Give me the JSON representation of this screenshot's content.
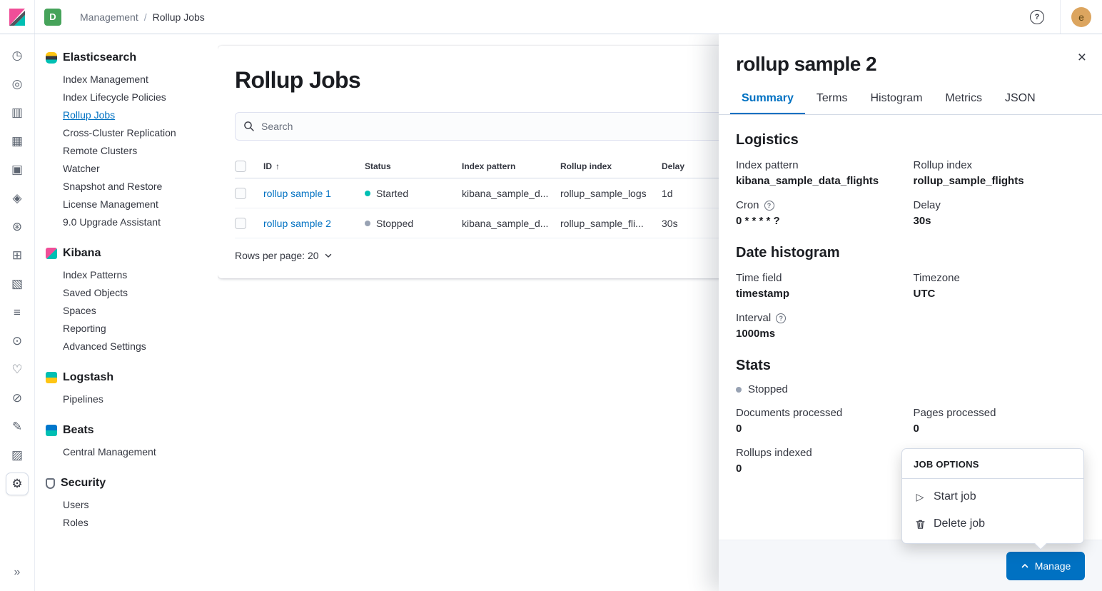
{
  "topbar": {
    "space_badge": "D",
    "breadcrumbs": [
      {
        "label": "Management"
      },
      {
        "label": "Rollup Jobs"
      }
    ],
    "separator": "/",
    "avatar_initial": "e"
  },
  "rail": {
    "icons": [
      {
        "name": "recent",
        "glyph": "◷"
      },
      {
        "name": "discover",
        "glyph": "◎"
      },
      {
        "name": "visualize",
        "glyph": "▥"
      },
      {
        "name": "dashboard",
        "glyph": "▦"
      },
      {
        "name": "canvas",
        "glyph": "▣"
      },
      {
        "name": "maps",
        "glyph": "◈"
      },
      {
        "name": "machine-learning",
        "glyph": "⊛"
      },
      {
        "name": "graph",
        "glyph": "⊞"
      },
      {
        "name": "metrics",
        "glyph": "▧"
      },
      {
        "name": "logs",
        "glyph": "≡"
      },
      {
        "name": "apm",
        "glyph": "⊙"
      },
      {
        "name": "uptime",
        "glyph": "♡"
      },
      {
        "name": "siem",
        "glyph": "⊘"
      },
      {
        "name": "dev-tools",
        "glyph": "✎"
      },
      {
        "name": "stack-monitoring",
        "glyph": "▨"
      },
      {
        "name": "stack-management",
        "glyph": "⚙",
        "selected": true
      }
    ],
    "collapse_glyph": "»"
  },
  "sidebar": {
    "selected_item": "Rollup Jobs",
    "sections": [
      {
        "title": "Elasticsearch",
        "items": [
          "Index Management",
          "Index Lifecycle Policies",
          "Rollup Jobs",
          "Cross-Cluster Replication",
          "Remote Clusters",
          "Watcher",
          "Snapshot and Restore",
          "License Management",
          "9.0 Upgrade Assistant"
        ]
      },
      {
        "title": "Kibana",
        "items": [
          "Index Patterns",
          "Saved Objects",
          "Spaces",
          "Reporting",
          "Advanced Settings"
        ]
      },
      {
        "title": "Logstash",
        "items": [
          "Pipelines"
        ]
      },
      {
        "title": "Beats",
        "items": [
          "Central Management"
        ]
      },
      {
        "title": "Security",
        "items": [
          "Users",
          "Roles"
        ]
      }
    ]
  },
  "main": {
    "title": "Rollup Jobs",
    "search": {
      "placeholder": "Search"
    },
    "table": {
      "columns": [
        "ID",
        "Status",
        "Index pattern",
        "Rollup index",
        "Delay"
      ],
      "rows": [
        {
          "id": "rollup sample 1",
          "status": "Started",
          "index_pattern": "kibana_sample_d...",
          "rollup_index": "rollup_sample_logs",
          "delay": "1d"
        },
        {
          "id": "rollup sample 2",
          "status": "Stopped",
          "index_pattern": "kibana_sample_d...",
          "rollup_index": "rollup_sample_fli...",
          "delay": "30s"
        }
      ]
    },
    "rows_per_page": "Rows per page: 20"
  },
  "flyout": {
    "title": "rollup sample 2",
    "tabs": [
      {
        "label": "Summary",
        "active": true
      },
      {
        "label": "Terms"
      },
      {
        "label": "Histogram"
      },
      {
        "label": "Metrics"
      },
      {
        "label": "JSON"
      }
    ],
    "sections": [
      {
        "title": "Logistics",
        "items": [
          {
            "label": "Index pattern",
            "value": "kibana_sample_data_flights"
          },
          {
            "label": "Rollup index",
            "value": "rollup_sample_flights"
          },
          {
            "label": "Cron",
            "value": "0 * * * * ?",
            "help": true
          },
          {
            "label": "Delay",
            "value": "30s"
          }
        ]
      },
      {
        "title": "Date histogram",
        "items": [
          {
            "label": "Time field",
            "value": "timestamp"
          },
          {
            "label": "Timezone",
            "value": "UTC"
          },
          {
            "label": "Interval",
            "value": "1000ms",
            "help": true
          }
        ]
      },
      {
        "title": "Stats",
        "status": {
          "label": "Stopped"
        },
        "items": [
          {
            "label": "Documents processed",
            "value": "0"
          },
          {
            "label": "Pages processed",
            "value": "0"
          },
          {
            "label": "Rollups indexed",
            "value": "0"
          }
        ]
      }
    ],
    "manage_button": "Manage"
  },
  "popover": {
    "title": "JOB OPTIONS",
    "items": [
      {
        "label": "Start job",
        "icon": "play"
      },
      {
        "label": "Delete job",
        "icon": "trash"
      }
    ]
  },
  "icons": {
    "help": "?",
    "sort_asc": "↑",
    "close": "×",
    "play": "▷"
  },
  "colors": {
    "primary": "#0071C2",
    "started_dot": "#00BFB3",
    "stopped_dot": "#98A2B3",
    "space_badge": "#46A35A",
    "avatar_bg": "#DCA55F"
  }
}
